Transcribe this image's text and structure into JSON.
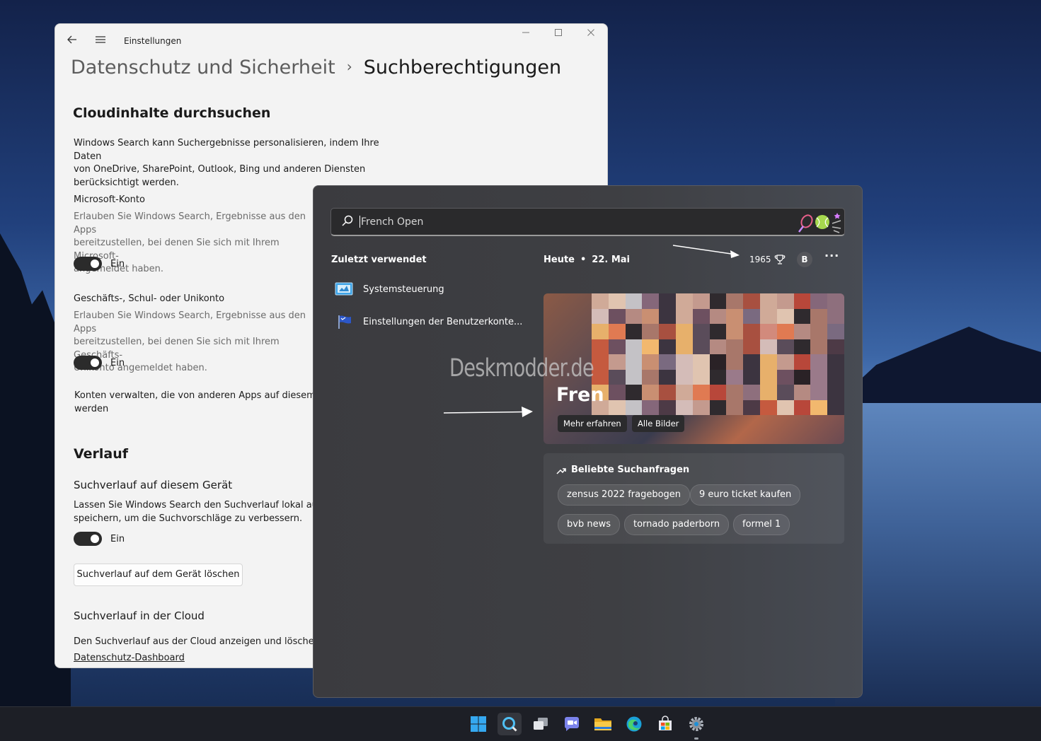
{
  "settings": {
    "window_title": "Einstellungen",
    "breadcrumb_parent": "Datenschutz und Sicherheit",
    "breadcrumb_current": "Suchberechtigungen",
    "cloud_heading": "Cloudinhalte durchsuchen",
    "cloud_text_1": "Windows Search kann Suchergebnisse personalisieren, indem Ihre Daten",
    "cloud_text_2": "von OneDrive, SharePoint, Outlook, Bing und anderen Diensten",
    "cloud_text_3": "berücksichtigt werden.",
    "ms_account_title": "Microsoft-Konto",
    "ms_account_desc_1": "Erlauben Sie Windows Search, Ergebnisse aus den Apps",
    "ms_account_desc_2": "bereitzustellen, bei denen Sie sich mit Ihrem Microsoft-",
    "ms_account_desc_3": "angemeldet haben.",
    "ms_account_toggle": "Ein",
    "work_account_title": "Geschäfts-, Schul- oder Unikonto",
    "work_account_desc_1": "Erlauben Sie Windows Search, Ergebnisse aus den Apps",
    "work_account_desc_2": "bereitzustellen, bei denen Sie sich mit Ihrem Geschäfts-",
    "work_account_desc_3": "Unikonto angemeldet haben.",
    "work_account_toggle": "Ein",
    "manage_accounts_1": "Konten verwalten, die von anderen Apps auf diesem Ge",
    "manage_accounts_2": "werden",
    "history_heading": "Verlauf",
    "device_history_title": "Suchverlauf auf diesem Gerät",
    "device_history_desc_1": "Lassen Sie Windows Search den Suchverlauf lokal auf d",
    "device_history_desc_2": "speichern, um die Suchvorschläge zu verbessern.",
    "device_history_toggle": "Ein",
    "clear_history_button": "Suchverlauf auf dem Gerät löschen",
    "cloud_history_title": "Suchverlauf in der Cloud",
    "cloud_history_desc": "Den Suchverlauf aus der Cloud anzeigen und löschen",
    "privacy_dashboard_link": "Datenschutz-Dashboard"
  },
  "search": {
    "query_placeholder": "French Open",
    "recent_heading": "Zuletzt verwendet",
    "recent_items": [
      {
        "label": "Systemsteuerung",
        "icon": "control-panel-icon"
      },
      {
        "label": "Einstellungen der Benutzerkonte...",
        "icon": "user-accounts-flag-icon"
      }
    ],
    "today_label": "Heute",
    "today_date": "22. Mai",
    "rewards_points": "1965",
    "avatar_initial": "B",
    "more_label": "···",
    "hero_title": "Fren",
    "hero_learn_more": "Mehr erfahren",
    "hero_all_images": "Alle Bilder",
    "watermark": "Deskmodder.de",
    "popular_heading": "Beliebte Suchanfragen",
    "popular_queries": [
      "zensus 2022 fragebogen",
      "9 euro ticket kaufen",
      "bvb news",
      "tornado paderborn",
      "formel 1"
    ]
  },
  "taskbar": {
    "icons": [
      "start-icon",
      "search-icon",
      "task-view-icon",
      "chat-icon",
      "file-explorer-icon",
      "edge-icon",
      "store-icon",
      "settings-icon"
    ]
  },
  "colors": {
    "accent": "#0078d4",
    "toggle_on": "#2b2b2b"
  }
}
